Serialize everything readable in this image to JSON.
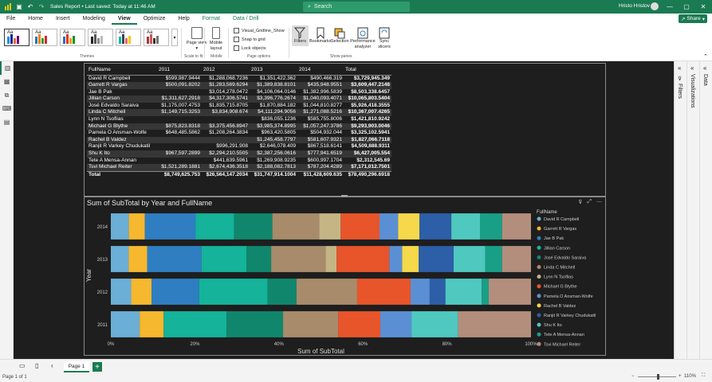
{
  "title_bar": {
    "doc_title": "Sales Report • Last saved: Today at 11:46 AM",
    "search_placeholder": "Search",
    "user": "Hristo Hristov",
    "accent": "#1a7a52"
  },
  "menu": {
    "items": [
      "File",
      "Home",
      "Insert",
      "Modeling",
      "View",
      "Optimize",
      "Help",
      "Format",
      "Data / Drill"
    ],
    "active": "View",
    "share_label": "Share"
  },
  "ribbon": {
    "themes_label": "Themes",
    "scale_label": "Scale to fit",
    "mobile_group_label": "Mobile",
    "page_options_label": "Page options",
    "show_panes_label": "Show panes",
    "page_view_label": "Page view",
    "mobile_layout_label": "Mobile layout",
    "checks": [
      "Visual_Gridline_Show",
      "Snap to grid",
      "Lock objects"
    ],
    "panes": [
      "Filters",
      "Bookmarks",
      "Selection",
      "Performance analyzer",
      "Sync slicers"
    ]
  },
  "table": {
    "headers": [
      "FullName",
      "2011",
      "2012",
      "2013",
      "2014",
      "Total"
    ],
    "rows": [
      [
        "David R Campbell",
        "$599,987.9444",
        "$1,288,068.7236",
        "$1,351,422.362",
        "$490,466.319",
        "$3,729,945.349"
      ],
      [
        "Garrett R Vargas",
        "$500,091.8202",
        "$1,283,569.6294",
        "$1,389,838.8101",
        "$435,948.9551",
        "$3,609,447.2148"
      ],
      [
        "Jae B Pak",
        "",
        "$3,014,278.0472",
        "$4,106,064.0146",
        "$1,382,996.5839",
        "$8,503,338.6457"
      ],
      [
        "Jillian Carson",
        "$1,311,627.2918",
        "$4,317,306.5741",
        "$3,396,776.2674",
        "$1,040,093.4071",
        "$10,065,803.5404"
      ],
      [
        "José Edvaldo Saraiva",
        "$1,175,007.4753",
        "$1,835,715.8705",
        "$1,870,884.182",
        "$1,044,810.8277",
        "$5,926,418.3555"
      ],
      [
        "Linda C Mitchell",
        "$1,149,715.3253",
        "$3,834,908.674",
        "$4,111,294.9056",
        "$1,271,088.5216",
        "$10,367,007.4265"
      ],
      [
        "Lynn N Tsoflias",
        "",
        "",
        "$836,055.1236",
        "$585,755.8006",
        "$1,421,810.9242"
      ],
      [
        "Michael G Blythe",
        "$875,823.8318",
        "$3,375,456.8947",
        "$3,985,374.8995",
        "$1,057,247.3786",
        "$9,293,903.0046"
      ],
      [
        "Pamela O Ansman-Wolfe",
        "$648,485.5862",
        "$1,208,264.3834",
        "$963,420.5805",
        "$504,932.044",
        "$3,325,102.5941"
      ],
      [
        "Rachel B Valdez",
        "",
        "",
        "$1,245,458.7797",
        "$581,607.9321",
        "$1,827,066.7118"
      ],
      [
        "Ranjit R Varkey Chudukatil",
        "",
        "$996,291.908",
        "$2,646,078.409",
        "$867,518.6141",
        "$4,509,888.9311"
      ],
      [
        "Shu K Ito",
        "$967,597.2899",
        "$2,294,210.5505",
        "$2,387,256.0616",
        "$777,941.6519",
        "$6,427,005.554"
      ],
      [
        "Tete A Mensa-Annan",
        "",
        "$441,639.5961",
        "$1,269,908.9235",
        "$600,997.1704",
        "$2,312,545.69"
      ],
      [
        "Tsvi Michael Reiter",
        "$1,521,289.1881",
        "$2,674,436.3518",
        "$2,188,082.7813",
        "$787,204.4289",
        "$7,171,012.7501"
      ]
    ],
    "total_row": [
      "Total",
      "$8,749,625.753",
      "$26,564,147.2034",
      "$31,747,914.1004",
      "$11,428,609.635",
      "$78,490,296.6918"
    ]
  },
  "chart_data": {
    "type": "bar",
    "orientation": "horizontal-100%-stacked",
    "title": "Sum of SubTotal by Year and FullName",
    "xlabel": "Sum of SubTotal",
    "ylabel": "Year",
    "xticks": [
      "0%",
      "20%",
      "40%",
      "60%",
      "80%",
      "100%"
    ],
    "categories": [
      "2014",
      "2013",
      "2012",
      "2011"
    ],
    "legend_title": "FullName",
    "legend_position": "right",
    "series": [
      {
        "name": "David R Campbell",
        "color": "#6baed6",
        "values": [
          490466.319,
          1351422.362,
          1288068.7236,
          599987.9444
        ]
      },
      {
        "name": "Garrett R Vargas",
        "color": "#f5b82e",
        "values": [
          435948.9551,
          1389838.8101,
          1283569.6294,
          500091.8202
        ]
      },
      {
        "name": "Jae B Pak",
        "color": "#2f7ec1",
        "values": [
          1382996.5839,
          4106064.0146,
          3014278.0472,
          0
        ]
      },
      {
        "name": "Jillian Carson",
        "color": "#14b39a",
        "values": [
          1040093.4071,
          3396776.2674,
          4317306.5741,
          1311627.2918
        ]
      },
      {
        "name": "José Edvaldo Saraiva",
        "color": "#10876c",
        "values": [
          1044810.8277,
          1870884.182,
          1835715.8705,
          1175007.4753
        ]
      },
      {
        "name": "Linda C Mitchell",
        "color": "#a88b6a",
        "values": [
          1271088.5216,
          4111294.9056,
          3834908.674,
          1149715.3253
        ]
      },
      {
        "name": "Lynn N Tsoflias",
        "color": "#c5b585",
        "values": [
          585755.8006,
          836055.1236,
          0,
          0
        ]
      },
      {
        "name": "Michael G Blythe",
        "color": "#e8552a",
        "values": [
          1057247.3786,
          3985374.8995,
          3375456.8947,
          875823.8318
        ]
      },
      {
        "name": "Pamela O Ansman-Wolfe",
        "color": "#5b8fd4",
        "values": [
          504932.044,
          963420.5805,
          1208264.3834,
          648485.5862
        ]
      },
      {
        "name": "Rachel B Valdez",
        "color": "#f5d94a",
        "values": [
          581607.9321,
          1245458.7797,
          0,
          0
        ]
      },
      {
        "name": "Ranjit R Varkey Chudukatil",
        "color": "#2d5ea8",
        "values": [
          867518.6141,
          2646078.409,
          996291.908,
          0
        ]
      },
      {
        "name": "Shu K Ito",
        "color": "#4fc9c0",
        "values": [
          777941.6519,
          2387256.0616,
          2294210.5505,
          967597.2899
        ]
      },
      {
        "name": "Tete A Mensa-Annan",
        "color": "#199f86",
        "values": [
          600997.1704,
          1269908.9235,
          441639.5961,
          0
        ]
      },
      {
        "name": "Tsvi Michael Reiter",
        "color": "#b38e7d",
        "values": [
          787204.4289,
          2188082.7813,
          2674436.3518,
          1521289.1881
        ]
      }
    ]
  },
  "right_panes": {
    "filters_label": "Filters",
    "visualizations_label": "Visualizations",
    "data_label": "Data"
  },
  "pages": {
    "tab": "Page 1"
  },
  "status": {
    "page_info": "Page 1 of 1",
    "zoom": "110%"
  }
}
